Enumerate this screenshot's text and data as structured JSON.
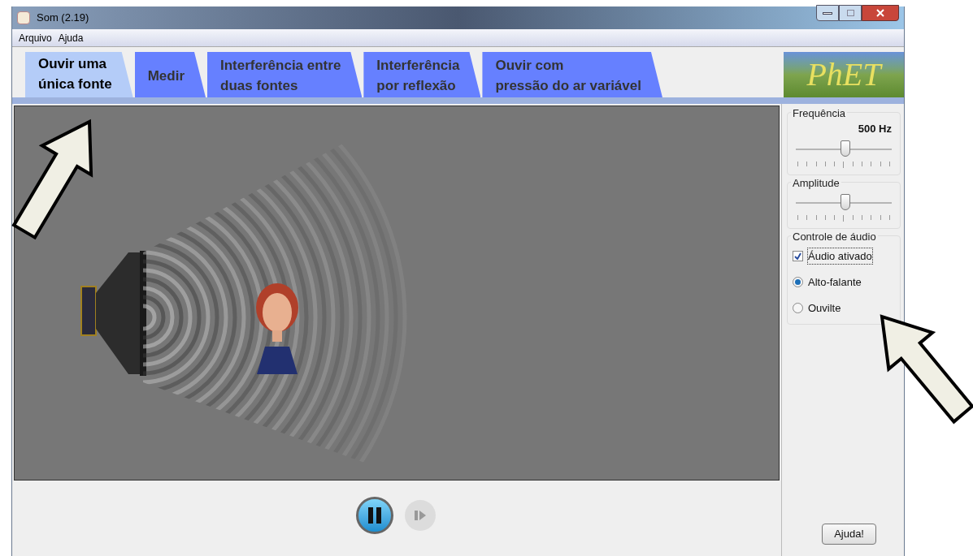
{
  "window": {
    "title": "Som (2.19)"
  },
  "menu": [
    "Arquivo",
    "Ajuda"
  ],
  "tabs": [
    {
      "label": "Ouvir uma\núnica fonte",
      "selected": true
    },
    {
      "label": "Medir",
      "selected": false
    },
    {
      "label": "Interferência entre\nduas fontes",
      "selected": false
    },
    {
      "label": "Interferência\npor reflexão",
      "selected": false
    },
    {
      "label": "Ouvir com\npressão do ar variável",
      "selected": false
    }
  ],
  "logo": {
    "text": "PhET"
  },
  "controls": {
    "frequency": {
      "title": "Frequência",
      "reading": "500 Hz",
      "level": 0.52
    },
    "amplitude": {
      "title": "Amplitude",
      "level": 0.52
    },
    "audio": {
      "title": "Controle de áudio",
      "enabled": {
        "label": "Áudio ativado",
        "checked": true
      },
      "outputs": [
        {
          "label": "Alto-falante",
          "selected": true
        },
        {
          "label": "Ouvilte",
          "selected": false
        }
      ]
    }
  },
  "playback": {
    "playing": true,
    "step_disabled": true
  },
  "help_button": "Ajuda!"
}
